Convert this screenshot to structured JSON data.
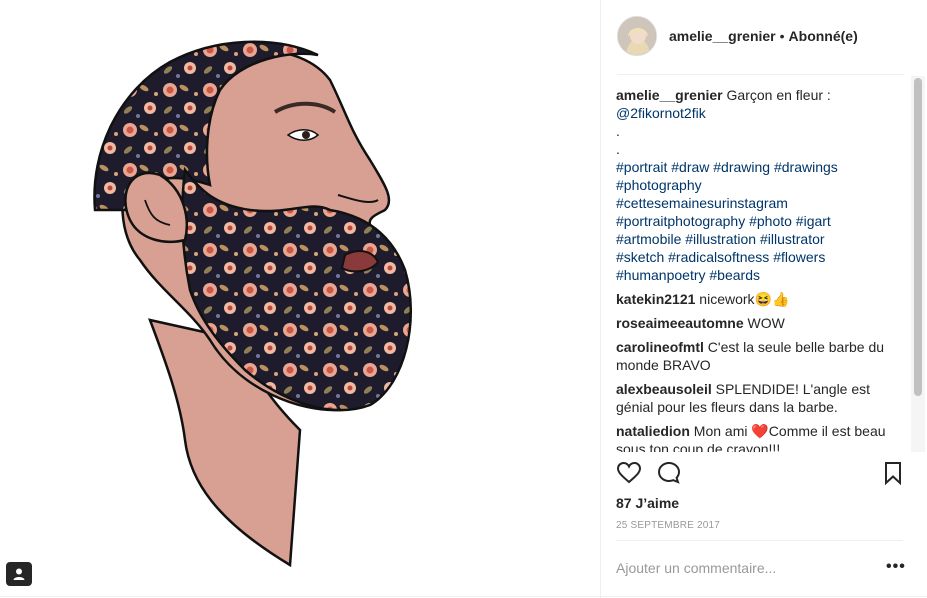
{
  "post": {
    "username": "amelie__grenier",
    "separator": "•",
    "follow_status": "Abonné(e)"
  },
  "caption": {
    "username": "amelie__grenier",
    "text": "Garçon en fleur :",
    "mention": "@2fikornot2fik",
    "dot1": ".",
    "dot2": ".",
    "hashtags": [
      "#portrait #draw #drawing #drawings",
      "#photography",
      "#cettesemainesurinstagram",
      "#portraitphotography #photo #igart",
      "#artmobile #illustration #illustrator",
      "#sketch #radicalsoftness #flowers",
      "#humanpoetry #beards"
    ]
  },
  "comments": [
    {
      "username": "katekin2121",
      "text": "nicework😆👍"
    },
    {
      "username": "roseaimeeautomne",
      "text": "WOW"
    },
    {
      "username": "carolineofmtl",
      "text": "C'est la seule belle barbe du monde BRAVO"
    },
    {
      "username": "alexbeausoleil",
      "text": "SPLENDIDE! L'angle est génial pour les fleurs dans la barbe."
    },
    {
      "username": "nataliedion",
      "text": "Mon ami ❤️Comme il est beau sous ton coup de crayon!!!"
    }
  ],
  "actions": {
    "like_icon": "heart-icon",
    "comment_icon": "comment-icon",
    "save_icon": "bookmark-icon",
    "likes": "87 J’aime",
    "date": "25 SEPTEMBRE 2017"
  },
  "composer": {
    "placeholder": "Ajouter un commentaire...",
    "more_label": "•••"
  },
  "colors": {
    "skin": "#d9a093",
    "flower_dark": "#1c1a2e",
    "text_link": "#003569"
  }
}
